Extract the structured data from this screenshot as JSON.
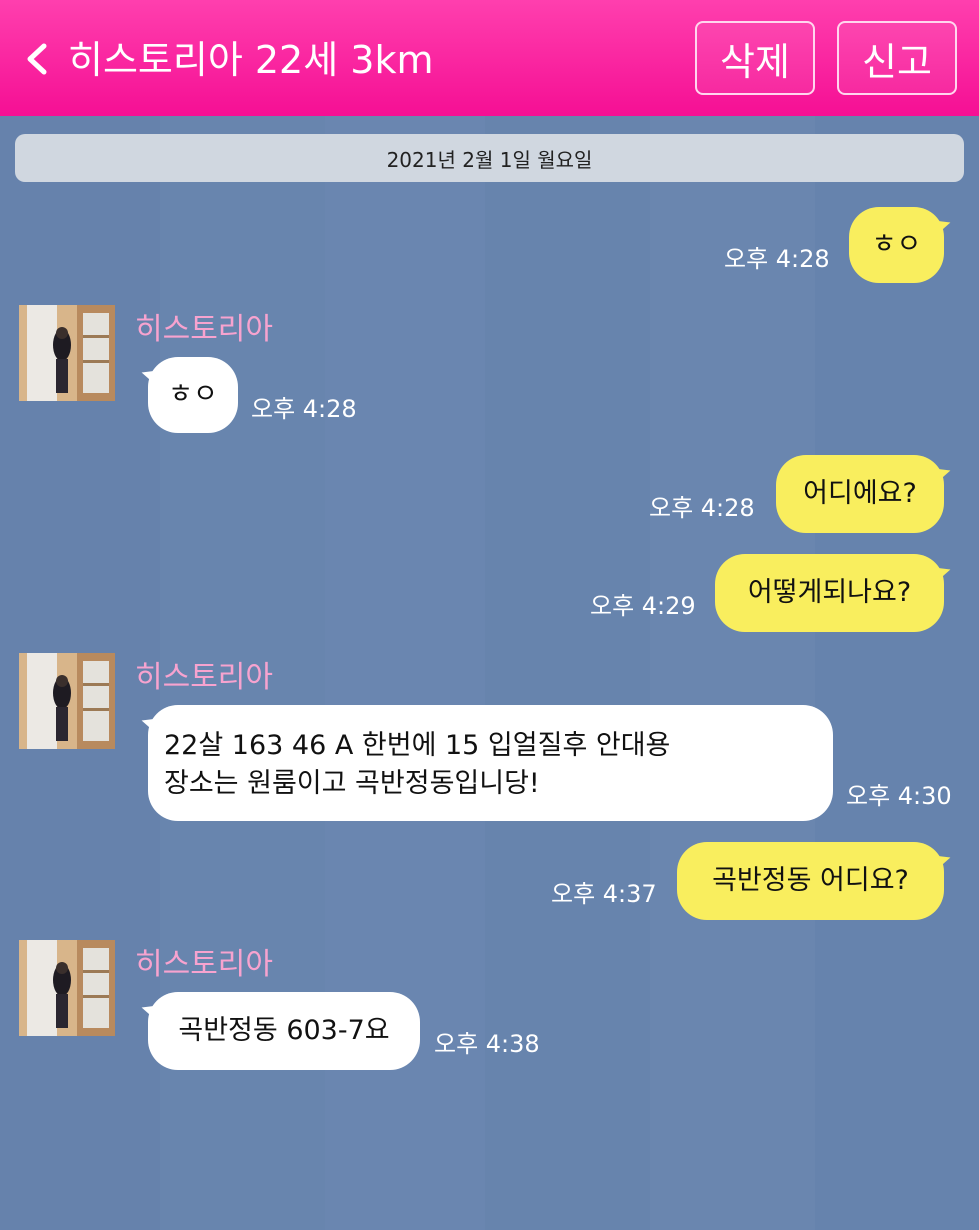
{
  "header": {
    "back_icon": "chevron-left-icon",
    "title": "히스토리아 22세 3km",
    "delete_label": "삭제",
    "report_label": "신고"
  },
  "date_divider": "2021년 2월 1일 월요일",
  "colors": {
    "header": "#f50f94",
    "background": "#6683ad",
    "my_bubble": "#f9ee5e",
    "their_bubble": "#ffffff",
    "sender_name": "#f7a3cf"
  },
  "messages": [
    {
      "from": "me",
      "text": "ㅎㅇ",
      "time": "오후 4:28"
    },
    {
      "from": "히스토리아",
      "sender": "히스토리아",
      "text": "ㅎㅇ",
      "time": "오후 4:28"
    },
    {
      "from": "me",
      "text": "어디에요?",
      "time": "오후 4:28"
    },
    {
      "from": "me",
      "text": "어떻게되나요?",
      "time": "오후 4:29"
    },
    {
      "from": "히스토리아",
      "sender": "히스토리아",
      "lines": [
        "22살 163 46 A 한번에 15 입얼질후 안대용",
        "장소는 원룸이고 곡반정동입니당!"
      ],
      "time": "오후 4:30"
    },
    {
      "from": "me",
      "text": "곡반정동 어디요?",
      "time": "오후 4:37"
    },
    {
      "from": "히스토리아",
      "sender": "히스토리아",
      "text": "곡반정동 603-7요",
      "time": "오후 4:38"
    }
  ]
}
